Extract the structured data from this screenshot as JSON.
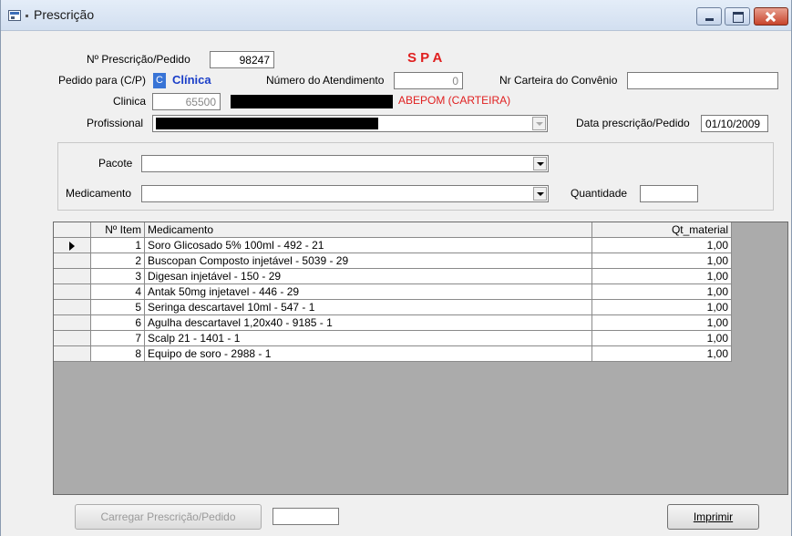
{
  "window": {
    "title": "Prescrição"
  },
  "header": {
    "prescricao_label": "Nº Prescrição/Pedido",
    "prescricao_value": "98247",
    "spa_label": "S P A",
    "pedido_para_label": "Pedido para (C/P)",
    "pedido_para_value": "C",
    "pedido_para_text": "Clínica",
    "atendimento_label": "Número do Atendimento",
    "atendimento_value": "0",
    "carteira_label": "Nr Carteira do Convênio",
    "carteira_value": "",
    "clinica_label": "Clinica",
    "clinica_value": "65500",
    "convenio_name": "ABEPOM (CARTEIRA)",
    "profissional_label": "Profissional",
    "data_label": "Data prescrição/Pedido",
    "data_value": "01/10/2009"
  },
  "filters": {
    "pacote_label": "Pacote",
    "pacote_value": "",
    "medicamento_label": "Medicamento",
    "medicamento_value": "",
    "quantidade_label": "Quantidade",
    "quantidade_value": ""
  },
  "grid": {
    "columns": [
      "Nº Item",
      "Medicamento",
      "Qt_material"
    ],
    "rows": [
      {
        "item": "1",
        "medicamento": "Soro Glicosado 5% 100ml  -  492  -  21",
        "qt": "1,00"
      },
      {
        "item": "2",
        "medicamento": "Buscopan Composto injetável  -  5039  -  29",
        "qt": "1,00"
      },
      {
        "item": "3",
        "medicamento": "Digesan injetável  -  150  -  29",
        "qt": "1,00"
      },
      {
        "item": "4",
        "medicamento": "Antak 50mg injetavel  -  446  -  29",
        "qt": "1,00"
      },
      {
        "item": "5",
        "medicamento": "Seringa descartavel 10ml  -  547  -  1",
        "qt": "1,00"
      },
      {
        "item": "6",
        "medicamento": "Agulha descartavel 1,20x40  -  9185  -  1",
        "qt": "1,00"
      },
      {
        "item": "7",
        "medicamento": "Scalp 21  -  1401  -  1",
        "qt": "1,00"
      },
      {
        "item": "8",
        "medicamento": "Equipo de soro  -  2988  -  1",
        "qt": "1,00"
      }
    ]
  },
  "footer": {
    "carregar_label": "Carregar Prescrição/Pedido",
    "carregar_input": "",
    "imprimir_label": "Imprimir"
  }
}
